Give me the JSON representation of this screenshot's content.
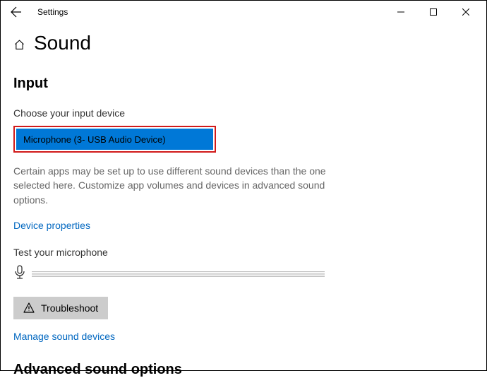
{
  "titlebar": {
    "title": "Settings"
  },
  "page": {
    "heading": "Sound"
  },
  "input_section": {
    "heading": "Input",
    "choose_label": "Choose your input device",
    "selected_device": "Microphone (3- USB Audio Device)",
    "help_text": "Certain apps may be set up to use different sound devices than the one selected here. Customize app volumes and devices in advanced sound options.",
    "device_properties_link": "Device properties",
    "test_label": "Test your microphone",
    "troubleshoot_label": "Troubleshoot",
    "manage_link": "Manage sound devices"
  },
  "advanced_section": {
    "heading": "Advanced sound options"
  }
}
